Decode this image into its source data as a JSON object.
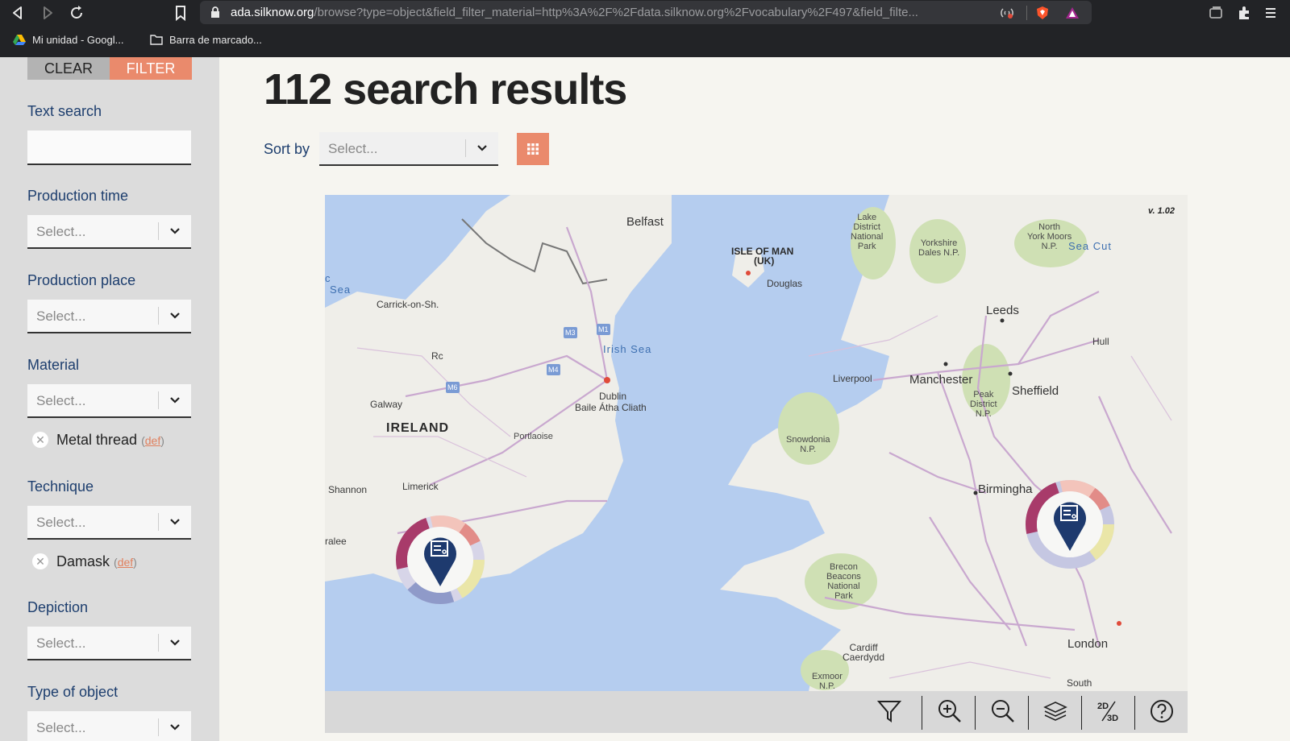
{
  "browser": {
    "url_host": "ada.silknow.org",
    "url_path": "/browse?type=object&field_filter_material=http%3A%2F%2Fdata.silknow.org%2Fvocabulary%2F497&field_filte...",
    "bookmarks": [
      "Mi unidad - Googl...",
      "Barra de marcado..."
    ]
  },
  "sidebar": {
    "clear_label": "CLEAR",
    "filter_label": "FILTER",
    "text_search_label": "Text search",
    "select_placeholder": "Select...",
    "filters": {
      "production_time": "Production time",
      "production_place": "Production place",
      "material": "Material",
      "technique": "Technique",
      "depiction": "Depiction",
      "type_of_object": "Type of object"
    },
    "chips": {
      "material": {
        "label": "Metal thread",
        "def": "def"
      },
      "technique": {
        "label": "Damask",
        "def": "def"
      }
    }
  },
  "main": {
    "title": "112 search results",
    "sort_label": "Sort by",
    "sort_placeholder": "Select..."
  },
  "map": {
    "version": "v. 1.02",
    "labels": {
      "belfast": "Belfast",
      "isle_of_man": "ISLE OF MAN",
      "uk": "(UK)",
      "douglas": "Douglas",
      "lake_district": "Lake\nDistrict\nNational\nPark",
      "yorkshire_dales": "Yorkshire\nDales N.P.",
      "north_york_moors": "North\nYork Moors\nN.P.",
      "sea_cut": "Sea Cut",
      "sea_left": "Sea",
      "c_left": "c",
      "carrick": "Carrick-on-Sh.",
      "irish_sea": "Irish Sea",
      "leeds": "Leeds",
      "hull": "Hull",
      "liverpool": "Liverpool",
      "manchester": "Manchester",
      "sheffield": "Sheffield",
      "peak_district": "Peak\nDistrict\nN.P.",
      "dublin": "Dublin",
      "baile_atha_cliath": "Baile Átha Cliath",
      "galway": "Galway",
      "ireland": "IRELAND",
      "portlaoise": "Portlaoise",
      "snowdonia": "Snowdonia\nN.P.",
      "shannon": "Shannon",
      "limerick": "Limerick",
      "birmingham": "Birmingha",
      "tralee": "ralee",
      "brecon": "Brecon\nBeacons\nNational\nPark",
      "cardiff": "Cardiff\nCaerdydd",
      "exmoor": "Exmoor\nN.P.",
      "london": "London",
      "south": "South",
      "rc": "Rc",
      "m1": "M1",
      "m3": "M3",
      "m4": "M4",
      "m6": "M6"
    }
  },
  "colors": {
    "accent": "#ea8a6c",
    "label_blue": "#1d3e6e",
    "marker_navy": "#1e3a6e",
    "water": "#b5cdef",
    "land": "#efeee9",
    "park": "#cfe0b4"
  }
}
